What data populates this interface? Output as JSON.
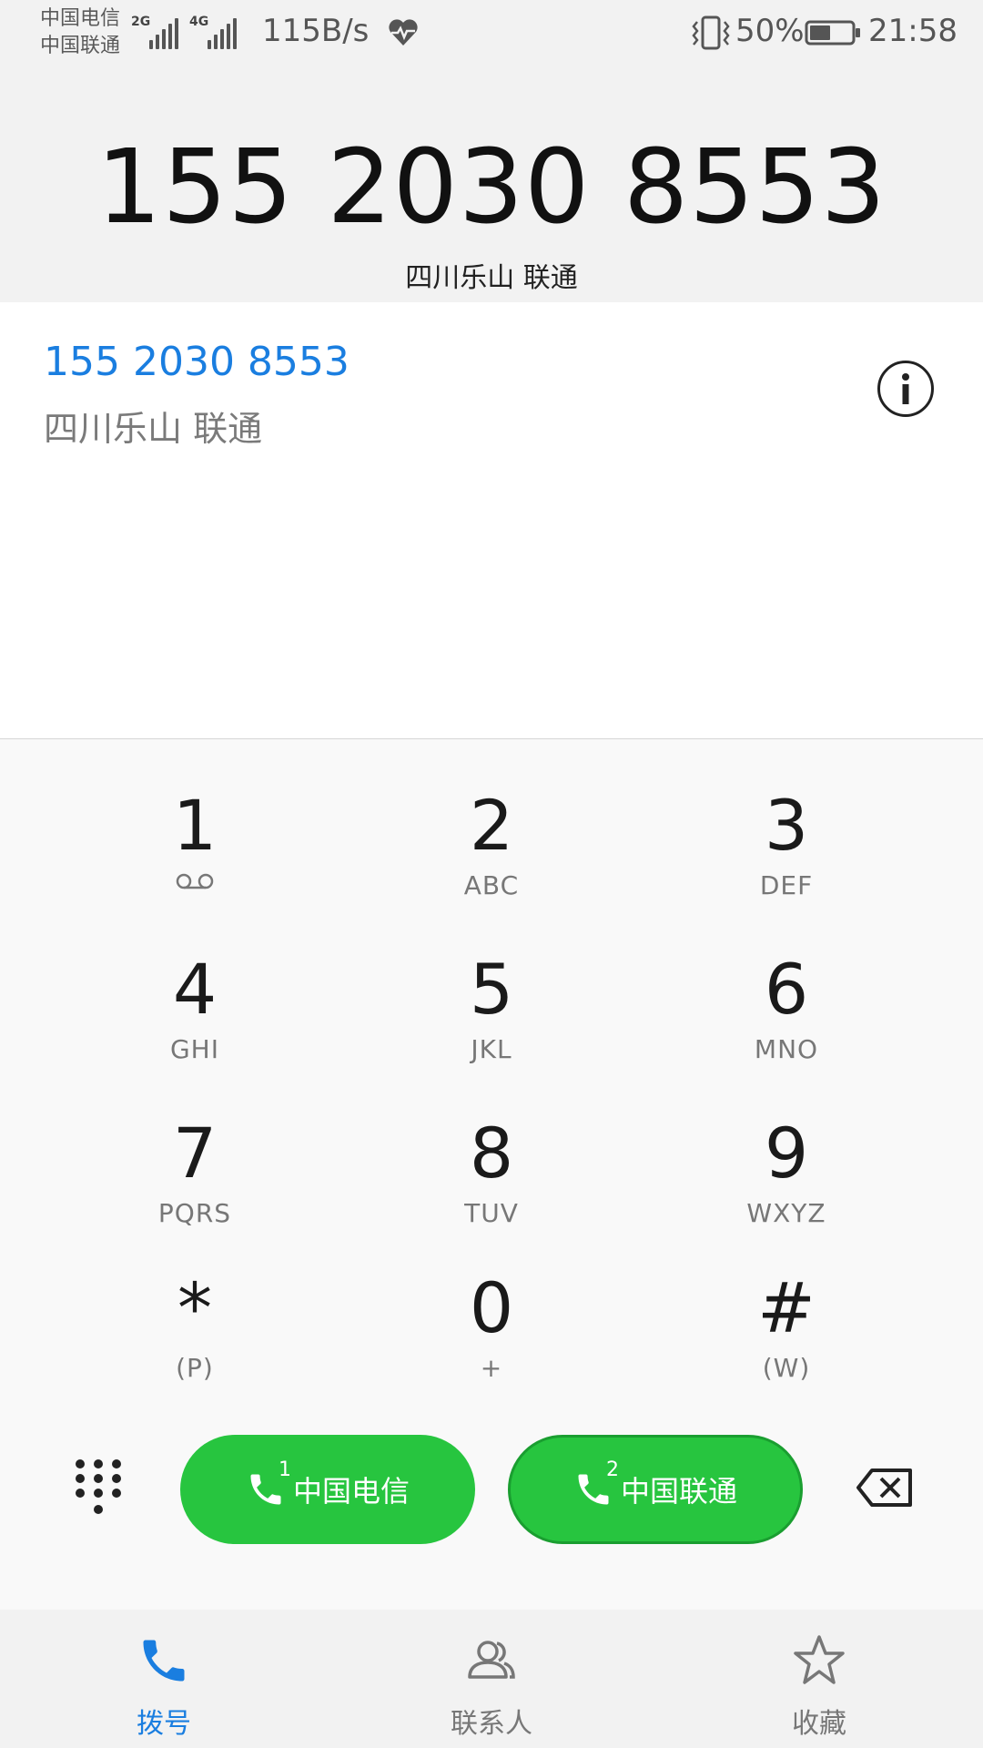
{
  "status_bar": {
    "carrier_1": "中国电信",
    "carrier_2": "中国联通",
    "network_1": "2G",
    "network_2": "4G",
    "speed": "115B/s",
    "battery": "50%",
    "time": "21:58",
    "battery_level": 0.5
  },
  "header": {
    "number": "155 2030 8553",
    "location": "四川乐山 联通"
  },
  "match": {
    "number": "155 2030 8553",
    "location": "四川乐山 联通"
  },
  "keypad": {
    "keys": [
      {
        "digit": "1",
        "letters": ""
      },
      {
        "digit": "2",
        "letters": "ABC"
      },
      {
        "digit": "3",
        "letters": "DEF"
      },
      {
        "digit": "4",
        "letters": "GHI"
      },
      {
        "digit": "5",
        "letters": "JKL"
      },
      {
        "digit": "6",
        "letters": "MNO"
      },
      {
        "digit": "7",
        "letters": "PQRS"
      },
      {
        "digit": "8",
        "letters": "TUV"
      },
      {
        "digit": "9",
        "letters": "WXYZ"
      },
      {
        "digit": "*",
        "letters": "(P)"
      },
      {
        "digit": "0",
        "letters": "+"
      },
      {
        "digit": "#",
        "letters": "(W)"
      }
    ]
  },
  "actions": {
    "sim1_label": "中国电信",
    "sim1_index": "1",
    "sim2_label": "中国联通",
    "sim2_index": "2"
  },
  "nav": {
    "dial": "拨号",
    "contacts": "联系人",
    "favorites": "收藏"
  },
  "colors": {
    "accent": "#1a7ee0",
    "call_green": "#27c53f"
  }
}
